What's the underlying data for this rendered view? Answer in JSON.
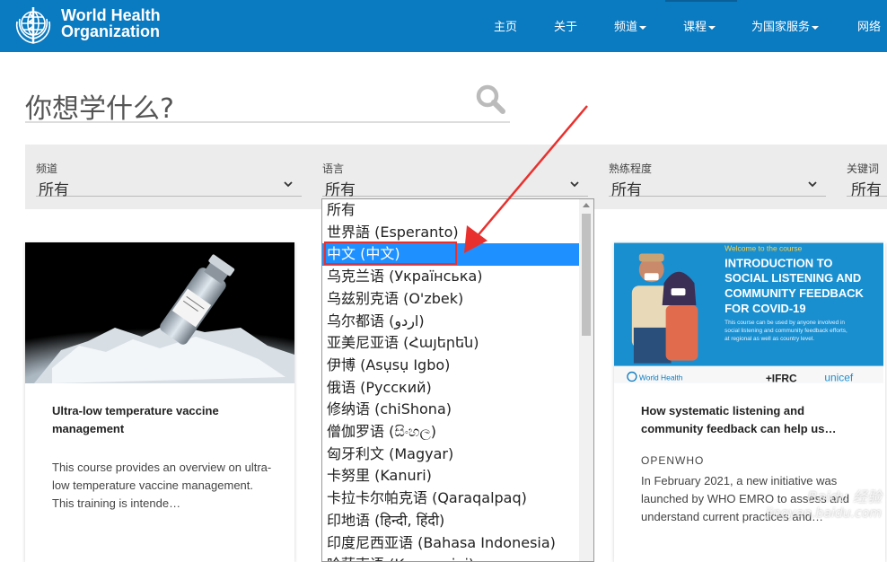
{
  "header": {
    "org_line1": "World Health",
    "org_line2": "Organization",
    "nav": [
      {
        "label": "主页",
        "dropdown": false
      },
      {
        "label": "关于",
        "dropdown": false
      },
      {
        "label": "频道",
        "dropdown": true
      },
      {
        "label": "课程",
        "dropdown": true
      },
      {
        "label": "为国家服务",
        "dropdown": true
      },
      {
        "label": "网络",
        "dropdown": false
      }
    ]
  },
  "search": {
    "title": "你想学什么?"
  },
  "filters": [
    {
      "label": "频道",
      "value": "所有"
    },
    {
      "label": "语言",
      "value": "所有"
    },
    {
      "label": "熟练程度",
      "value": "所有"
    },
    {
      "label": "关键词",
      "value": "所有"
    }
  ],
  "language_options": [
    "所有",
    "世界語 (Esperanto)",
    "中文 (中文)",
    "乌克兰语 (Українська)",
    "乌兹别克语 (O'zbek)",
    "乌尔都语 (اردو)",
    "亚美尼亚语 (Հայերեն)",
    "伊博 (Asụsụ Igbo)",
    "俄语 (Русский)",
    "修纳语 (chiShona)",
    "僧伽罗语 (සිංහල)",
    "匈牙利文 (Magyar)",
    "卡努里 (Kanuri)",
    "卡拉卡尔帕克语 (Qaraqalpaq)",
    "印地语 (हिन्दी, हिंदी)",
    "印度尼西亚语 (Bahasa Indonesia)",
    "哈萨克语 (Қазақ тілі)"
  ],
  "selected_language": "中文 (中文)",
  "cards": [
    {
      "title": "Ultra-low temperature vaccine management",
      "provider": "",
      "description": "This course provides an overview on ultra-low temperature vaccine management. This training is intende…"
    },
    {
      "title": "How systematic listening and community feedback can help us…",
      "provider": "OPENWHO",
      "description": "In February 2021, a new initiative was launched by WHO EMRO to assess and understand current practices and…"
    }
  ],
  "card2_image": {
    "welcome": "Welcome to the course",
    "headline_1": "INTRODUCTION TO",
    "headline_2": "SOCIAL LISTENING AND",
    "headline_3": "COMMUNITY FEEDBACK",
    "headline_4": "FOR COVID-19",
    "blurb_1": "This course can be used by anyone involved in",
    "blurb_2": "social listening and community feedback efforts,",
    "blurb_3": "at regional as well as country level.",
    "logo_who": "World Health",
    "logo_ifrc": "+IFRC",
    "logo_unicef": "unicef"
  },
  "watermark": {
    "line1": "Baidu 经验",
    "line2": "jingyan.baidu.com"
  },
  "colors": {
    "header_bg": "#0a7ac1",
    "selected_bg": "#1e90ff",
    "annotation": "#e8312e"
  }
}
